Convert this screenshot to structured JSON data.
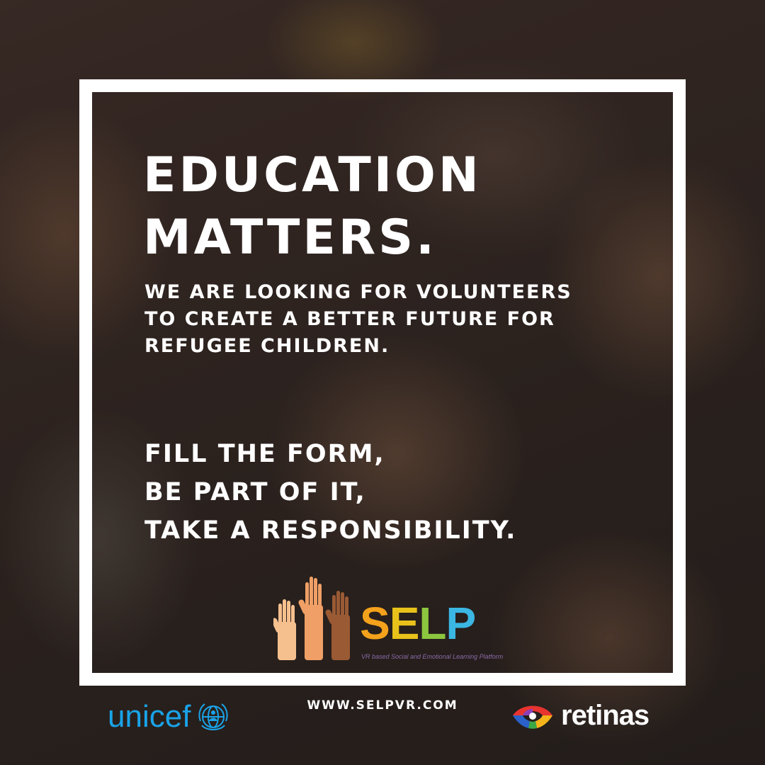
{
  "headline": {
    "lines": [
      "EDUCATION",
      "MATTERS."
    ]
  },
  "subtext": {
    "lines": [
      "WE ARE LOOKING FOR VOLUNTEERS",
      "TO CREATE A BETTER FUTURE FOR",
      "REFUGEE CHILDREN."
    ]
  },
  "cta": {
    "lines": [
      "FILL THE FORM,",
      "BE PART OF IT,",
      "TAKE A RESPONSIBILITY."
    ]
  },
  "selp_logo": {
    "letters": [
      "S",
      "E",
      "L",
      "P"
    ],
    "letter_colors": [
      "#f4a21c",
      "#e8c21a",
      "#8dc63f",
      "#3bb7e3"
    ],
    "tagline": "VR based Social and Emotional Learning Platform"
  },
  "footer": {
    "url": "WWW.SELPVR.COM",
    "unicef_label": "unicef",
    "retinas_label": "retinas"
  },
  "colors": {
    "frame": "#ffffff",
    "unicef_blue": "#1aa3e8",
    "text": "#ffffff"
  }
}
